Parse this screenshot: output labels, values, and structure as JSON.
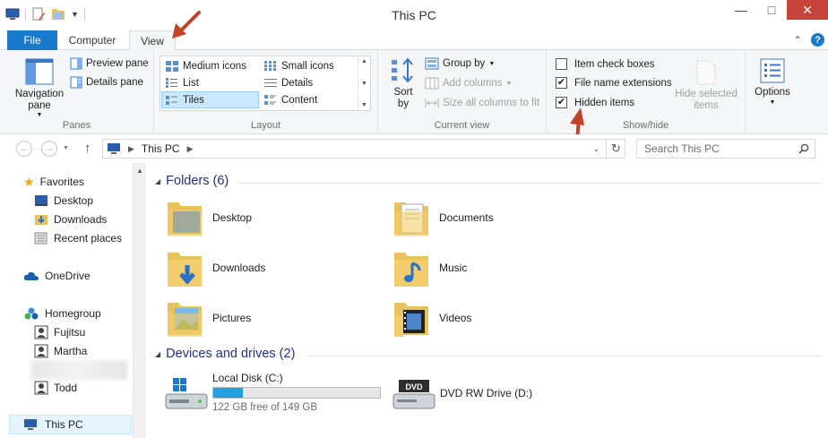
{
  "window": {
    "title": "This PC"
  },
  "colors": {
    "accent": "#1979ca",
    "close": "#c7423b",
    "selection": "#cce8ff",
    "header": "#1e3287",
    "folder": "#f3cd6b",
    "progress": "#26a0da",
    "annotation_arrow": "#c1442a"
  },
  "tabs": {
    "file": "File",
    "computer": "Computer",
    "view": "View"
  },
  "ribbon": {
    "panes": {
      "label": "Panes",
      "navigation_pane": "Navigation pane",
      "preview_pane": "Preview pane",
      "details_pane": "Details pane"
    },
    "layout": {
      "label": "Layout",
      "items": [
        "Medium icons",
        "Small icons",
        "List",
        "Details",
        "Tiles",
        "Content"
      ],
      "selected": "Tiles"
    },
    "current_view": {
      "label": "Current view",
      "sort_by": "Sort by",
      "group_by": "Group by",
      "add_columns": "Add columns",
      "size_all_columns": "Size all columns to fit"
    },
    "show_hide": {
      "label": "Show/hide",
      "item_check_boxes": {
        "label": "Item check boxes",
        "checked": false
      },
      "file_name_extensions": {
        "label": "File name extensions",
        "checked": true
      },
      "hidden_items": {
        "label": "Hidden items",
        "checked": true
      },
      "hide_selected_items": "Hide selected items"
    },
    "options": {
      "label": "Options"
    }
  },
  "address": {
    "path": "This PC",
    "search_placeholder": "Search This PC"
  },
  "nav": {
    "favorites": "Favorites",
    "desktop": "Desktop",
    "downloads": "Downloads",
    "recent_places": "Recent places",
    "onedrive": "OneDrive",
    "homegroup": "Homegroup",
    "fujitsu": "Fujitsu",
    "martha": "Martha",
    "todd": "Todd",
    "this_pc": "This PC"
  },
  "content": {
    "folders_header": "Folders (6)",
    "folders": [
      "Desktop",
      "Documents",
      "Downloads",
      "Music",
      "Pictures",
      "Videos"
    ],
    "devices_header": "Devices and drives (2)",
    "local_disk": {
      "name": "Local Disk (C:)",
      "free": "122 GB free of 149 GB",
      "used_fraction": 0.18
    },
    "dvd": {
      "name": "DVD RW Drive (D:)"
    }
  }
}
